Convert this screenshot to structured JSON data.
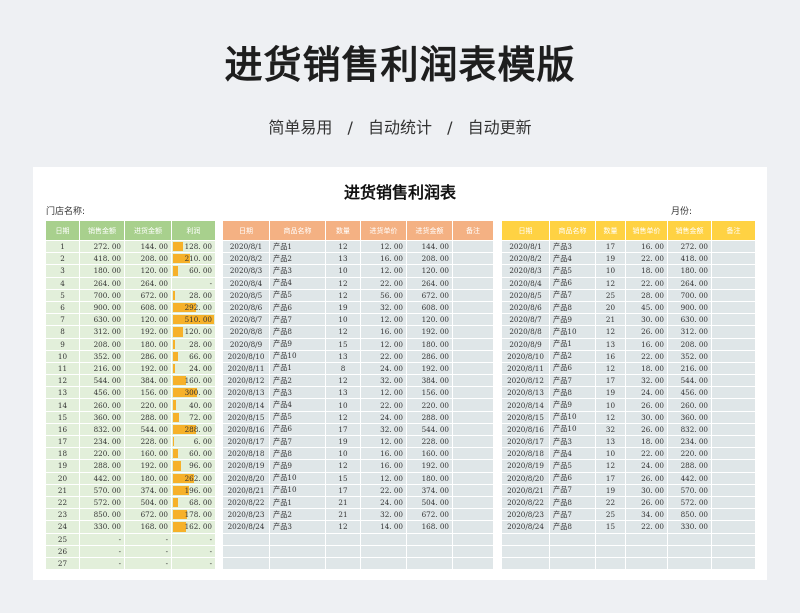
{
  "header": {
    "title": "进货销售利润表模版",
    "subtitle_items": [
      "简单易用",
      "自动统计",
      "自动更新"
    ],
    "separator": "/"
  },
  "sheet": {
    "title": "进货销售利润表",
    "store_label": "门店名称:",
    "month_label": "月份:"
  },
  "summary": {
    "headers": [
      "日期",
      "销售金额",
      "进货金额",
      "利润"
    ],
    "bar_color": "#f6b12a",
    "rows": [
      {
        "day": "1",
        "sales": "272. 00",
        "purchase": "144. 00",
        "profit": "128. 00",
        "level": 0.25
      },
      {
        "day": "2",
        "sales": "418. 00",
        "purchase": "208. 00",
        "profit": "210. 00",
        "level": 0.41
      },
      {
        "day": "3",
        "sales": "180. 00",
        "purchase": "120. 00",
        "profit": "60. 00",
        "level": 0.12
      },
      {
        "day": "4",
        "sales": "264. 00",
        "purchase": "264. 00",
        "profit": "-",
        "level": 0
      },
      {
        "day": "5",
        "sales": "700. 00",
        "purchase": "672. 00",
        "profit": "28. 00",
        "level": 0.05
      },
      {
        "day": "6",
        "sales": "900. 00",
        "purchase": "608. 00",
        "profit": "292. 00",
        "level": 0.57
      },
      {
        "day": "7",
        "sales": "630. 00",
        "purchase": "120. 00",
        "profit": "510. 00",
        "level": 1.0
      },
      {
        "day": "8",
        "sales": "312. 00",
        "purchase": "192. 00",
        "profit": "120. 00",
        "level": 0.24
      },
      {
        "day": "9",
        "sales": "208. 00",
        "purchase": "180. 00",
        "profit": "28. 00",
        "level": 0.05
      },
      {
        "day": "10",
        "sales": "352. 00",
        "purchase": "286. 00",
        "profit": "66. 00",
        "level": 0.13
      },
      {
        "day": "11",
        "sales": "216. 00",
        "purchase": "192. 00",
        "profit": "24. 00",
        "level": 0.05
      },
      {
        "day": "12",
        "sales": "544. 00",
        "purchase": "384. 00",
        "profit": "160. 00",
        "level": 0.31
      },
      {
        "day": "13",
        "sales": "456. 00",
        "purchase": "156. 00",
        "profit": "300. 00",
        "level": 0.59
      },
      {
        "day": "14",
        "sales": "260. 00",
        "purchase": "220. 00",
        "profit": "40. 00",
        "level": 0.08
      },
      {
        "day": "15",
        "sales": "360. 00",
        "purchase": "288. 00",
        "profit": "72. 00",
        "level": 0.14
      },
      {
        "day": "16",
        "sales": "832. 00",
        "purchase": "544. 00",
        "profit": "288. 00",
        "level": 0.56
      },
      {
        "day": "17",
        "sales": "234. 00",
        "purchase": "228. 00",
        "profit": "6. 00",
        "level": 0.01
      },
      {
        "day": "18",
        "sales": "220. 00",
        "purchase": "160. 00",
        "profit": "60. 00",
        "level": 0.12
      },
      {
        "day": "19",
        "sales": "288. 00",
        "purchase": "192. 00",
        "profit": "96. 00",
        "level": 0.19
      },
      {
        "day": "20",
        "sales": "442. 00",
        "purchase": "180. 00",
        "profit": "262. 00",
        "level": 0.51
      },
      {
        "day": "21",
        "sales": "570. 00",
        "purchase": "374. 00",
        "profit": "196. 00",
        "level": 0.38
      },
      {
        "day": "22",
        "sales": "572. 00",
        "purchase": "504. 00",
        "profit": "68. 00",
        "level": 0.13
      },
      {
        "day": "23",
        "sales": "850. 00",
        "purchase": "672. 00",
        "profit": "178. 00",
        "level": 0.35
      },
      {
        "day": "24",
        "sales": "330. 00",
        "purchase": "168. 00",
        "profit": "162. 00",
        "level": 0.32
      },
      {
        "day": "25",
        "sales": "-",
        "purchase": "-",
        "profit": "-",
        "level": 0
      },
      {
        "day": "26",
        "sales": "-",
        "purchase": "-",
        "profit": "-",
        "level": 0
      },
      {
        "day": "27",
        "sales": "-",
        "purchase": "-",
        "profit": "-",
        "level": 0
      }
    ]
  },
  "purchases": {
    "headers": [
      "日期",
      "商品名称",
      "数量",
      "进货单价",
      "进货金额",
      "备注"
    ],
    "rows": [
      {
        "date": "2020/8/1",
        "product": "产品1",
        "qty": "12",
        "price": "12. 00",
        "amount": "144. 00",
        "note": ""
      },
      {
        "date": "2020/8/2",
        "product": "产品2",
        "qty": "13",
        "price": "16. 00",
        "amount": "208. 00",
        "note": ""
      },
      {
        "date": "2020/8/3",
        "product": "产品3",
        "qty": "10",
        "price": "12. 00",
        "amount": "120. 00",
        "note": ""
      },
      {
        "date": "2020/8/4",
        "product": "产品4",
        "qty": "12",
        "price": "22. 00",
        "amount": "264. 00",
        "note": ""
      },
      {
        "date": "2020/8/5",
        "product": "产品5",
        "qty": "12",
        "price": "56. 00",
        "amount": "672. 00",
        "note": ""
      },
      {
        "date": "2020/8/6",
        "product": "产品6",
        "qty": "19",
        "price": "32. 00",
        "amount": "608. 00",
        "note": ""
      },
      {
        "date": "2020/8/7",
        "product": "产品7",
        "qty": "10",
        "price": "12. 00",
        "amount": "120. 00",
        "note": ""
      },
      {
        "date": "2020/8/8",
        "product": "产品8",
        "qty": "12",
        "price": "16. 00",
        "amount": "192. 00",
        "note": ""
      },
      {
        "date": "2020/8/9",
        "product": "产品9",
        "qty": "15",
        "price": "12. 00",
        "amount": "180. 00",
        "note": ""
      },
      {
        "date": "2020/8/10",
        "product": "产品10",
        "qty": "13",
        "price": "22. 00",
        "amount": "286. 00",
        "note": ""
      },
      {
        "date": "2020/8/11",
        "product": "产品1",
        "qty": "8",
        "price": "24. 00",
        "amount": "192. 00",
        "note": ""
      },
      {
        "date": "2020/8/12",
        "product": "产品2",
        "qty": "12",
        "price": "32. 00",
        "amount": "384. 00",
        "note": ""
      },
      {
        "date": "2020/8/13",
        "product": "产品3",
        "qty": "13",
        "price": "12. 00",
        "amount": "156. 00",
        "note": ""
      },
      {
        "date": "2020/8/14",
        "product": "产品4",
        "qty": "10",
        "price": "22. 00",
        "amount": "220. 00",
        "note": ""
      },
      {
        "date": "2020/8/15",
        "product": "产品5",
        "qty": "12",
        "price": "24. 00",
        "amount": "288. 00",
        "note": ""
      },
      {
        "date": "2020/8/16",
        "product": "产品6",
        "qty": "17",
        "price": "32. 00",
        "amount": "544. 00",
        "note": ""
      },
      {
        "date": "2020/8/17",
        "product": "产品7",
        "qty": "19",
        "price": "12. 00",
        "amount": "228. 00",
        "note": ""
      },
      {
        "date": "2020/8/18",
        "product": "产品8",
        "qty": "10",
        "price": "16. 00",
        "amount": "160. 00",
        "note": ""
      },
      {
        "date": "2020/8/19",
        "product": "产品9",
        "qty": "12",
        "price": "16. 00",
        "amount": "192. 00",
        "note": ""
      },
      {
        "date": "2020/8/20",
        "product": "产品10",
        "qty": "15",
        "price": "12. 00",
        "amount": "180. 00",
        "note": ""
      },
      {
        "date": "2020/8/21",
        "product": "产品10",
        "qty": "17",
        "price": "22. 00",
        "amount": "374. 00",
        "note": ""
      },
      {
        "date": "2020/8/22",
        "product": "产品1",
        "qty": "21",
        "price": "24. 00",
        "amount": "504. 00",
        "note": ""
      },
      {
        "date": "2020/8/23",
        "product": "产品2",
        "qty": "21",
        "price": "32. 00",
        "amount": "672. 00",
        "note": ""
      },
      {
        "date": "2020/8/24",
        "product": "产品3",
        "qty": "12",
        "price": "14. 00",
        "amount": "168. 00",
        "note": ""
      },
      {
        "date": "",
        "product": "",
        "qty": "",
        "price": "",
        "amount": "",
        "note": ""
      },
      {
        "date": "",
        "product": "",
        "qty": "",
        "price": "",
        "amount": "",
        "note": ""
      },
      {
        "date": "",
        "product": "",
        "qty": "",
        "price": "",
        "amount": "",
        "note": ""
      }
    ]
  },
  "sales": {
    "headers": [
      "日期",
      "商品名称",
      "数量",
      "销售单价",
      "销售金额",
      "备注"
    ],
    "rows": [
      {
        "date": "2020/8/1",
        "product": "产品3",
        "qty": "17",
        "price": "16. 00",
        "amount": "272. 00",
        "note": ""
      },
      {
        "date": "2020/8/2",
        "product": "产品4",
        "qty": "19",
        "price": "22. 00",
        "amount": "418. 00",
        "note": ""
      },
      {
        "date": "2020/8/3",
        "product": "产品5",
        "qty": "10",
        "price": "18. 00",
        "amount": "180. 00",
        "note": ""
      },
      {
        "date": "2020/8/4",
        "product": "产品6",
        "qty": "12",
        "price": "22. 00",
        "amount": "264. 00",
        "note": ""
      },
      {
        "date": "2020/8/5",
        "product": "产品7",
        "qty": "25",
        "price": "28. 00",
        "amount": "700. 00",
        "note": ""
      },
      {
        "date": "2020/8/6",
        "product": "产品8",
        "qty": "20",
        "price": "45. 00",
        "amount": "900. 00",
        "note": ""
      },
      {
        "date": "2020/8/7",
        "product": "产品9",
        "qty": "21",
        "price": "30. 00",
        "amount": "630. 00",
        "note": ""
      },
      {
        "date": "2020/8/8",
        "product": "产品10",
        "qty": "12",
        "price": "26. 00",
        "amount": "312. 00",
        "note": ""
      },
      {
        "date": "2020/8/9",
        "product": "产品1",
        "qty": "13",
        "price": "16. 00",
        "amount": "208. 00",
        "note": ""
      },
      {
        "date": "2020/8/10",
        "product": "产品2",
        "qty": "16",
        "price": "22. 00",
        "amount": "352. 00",
        "note": ""
      },
      {
        "date": "2020/8/11",
        "product": "产品6",
        "qty": "12",
        "price": "18. 00",
        "amount": "216. 00",
        "note": ""
      },
      {
        "date": "2020/8/12",
        "product": "产品7",
        "qty": "17",
        "price": "32. 00",
        "amount": "544. 00",
        "note": ""
      },
      {
        "date": "2020/8/13",
        "product": "产品8",
        "qty": "19",
        "price": "24. 00",
        "amount": "456. 00",
        "note": ""
      },
      {
        "date": "2020/8/14",
        "product": "产品9",
        "qty": "10",
        "price": "26. 00",
        "amount": "260. 00",
        "note": ""
      },
      {
        "date": "2020/8/15",
        "product": "产品10",
        "qty": "12",
        "price": "30. 00",
        "amount": "360. 00",
        "note": ""
      },
      {
        "date": "2020/8/16",
        "product": "产品10",
        "qty": "32",
        "price": "26. 00",
        "amount": "832. 00",
        "note": ""
      },
      {
        "date": "2020/8/17",
        "product": "产品3",
        "qty": "13",
        "price": "18. 00",
        "amount": "234. 00",
        "note": ""
      },
      {
        "date": "2020/8/18",
        "product": "产品4",
        "qty": "10",
        "price": "22. 00",
        "amount": "220. 00",
        "note": ""
      },
      {
        "date": "2020/8/19",
        "product": "产品5",
        "qty": "12",
        "price": "24. 00",
        "amount": "288. 00",
        "note": ""
      },
      {
        "date": "2020/8/20",
        "product": "产品6",
        "qty": "17",
        "price": "26. 00",
        "amount": "442. 00",
        "note": ""
      },
      {
        "date": "2020/8/21",
        "product": "产品7",
        "qty": "19",
        "price": "30. 00",
        "amount": "570. 00",
        "note": ""
      },
      {
        "date": "2020/8/22",
        "product": "产品8",
        "qty": "22",
        "price": "26. 00",
        "amount": "572. 00",
        "note": ""
      },
      {
        "date": "2020/8/23",
        "product": "产品7",
        "qty": "25",
        "price": "34. 00",
        "amount": "850. 00",
        "note": ""
      },
      {
        "date": "2020/8/24",
        "product": "产品8",
        "qty": "15",
        "price": "22. 00",
        "amount": "330. 00",
        "note": ""
      },
      {
        "date": "",
        "product": "",
        "qty": "",
        "price": "",
        "amount": "",
        "note": ""
      },
      {
        "date": "",
        "product": "",
        "qty": "",
        "price": "",
        "amount": "",
        "note": ""
      },
      {
        "date": "",
        "product": "",
        "qty": "",
        "price": "",
        "amount": "",
        "note": ""
      }
    ]
  }
}
